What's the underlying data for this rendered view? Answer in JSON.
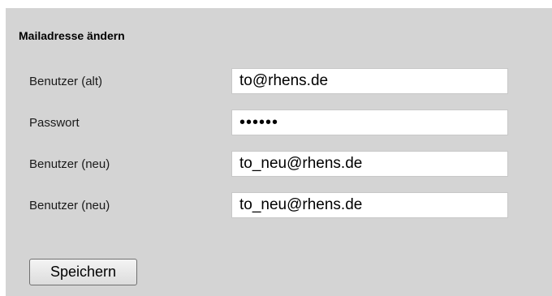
{
  "form": {
    "title": "Mailadresse ändern",
    "fields": [
      {
        "label": "Benutzer (alt)",
        "value": "to@rhens.de",
        "type": "text"
      },
      {
        "label": "Passwort",
        "value": "••••••",
        "type": "password"
      },
      {
        "label": "Benutzer (neu)",
        "value": "to_neu@rhens.de",
        "type": "text"
      },
      {
        "label": "Benutzer (neu)",
        "value": "to_neu@rhens.de",
        "type": "text"
      }
    ],
    "save_label": "Speichern"
  }
}
